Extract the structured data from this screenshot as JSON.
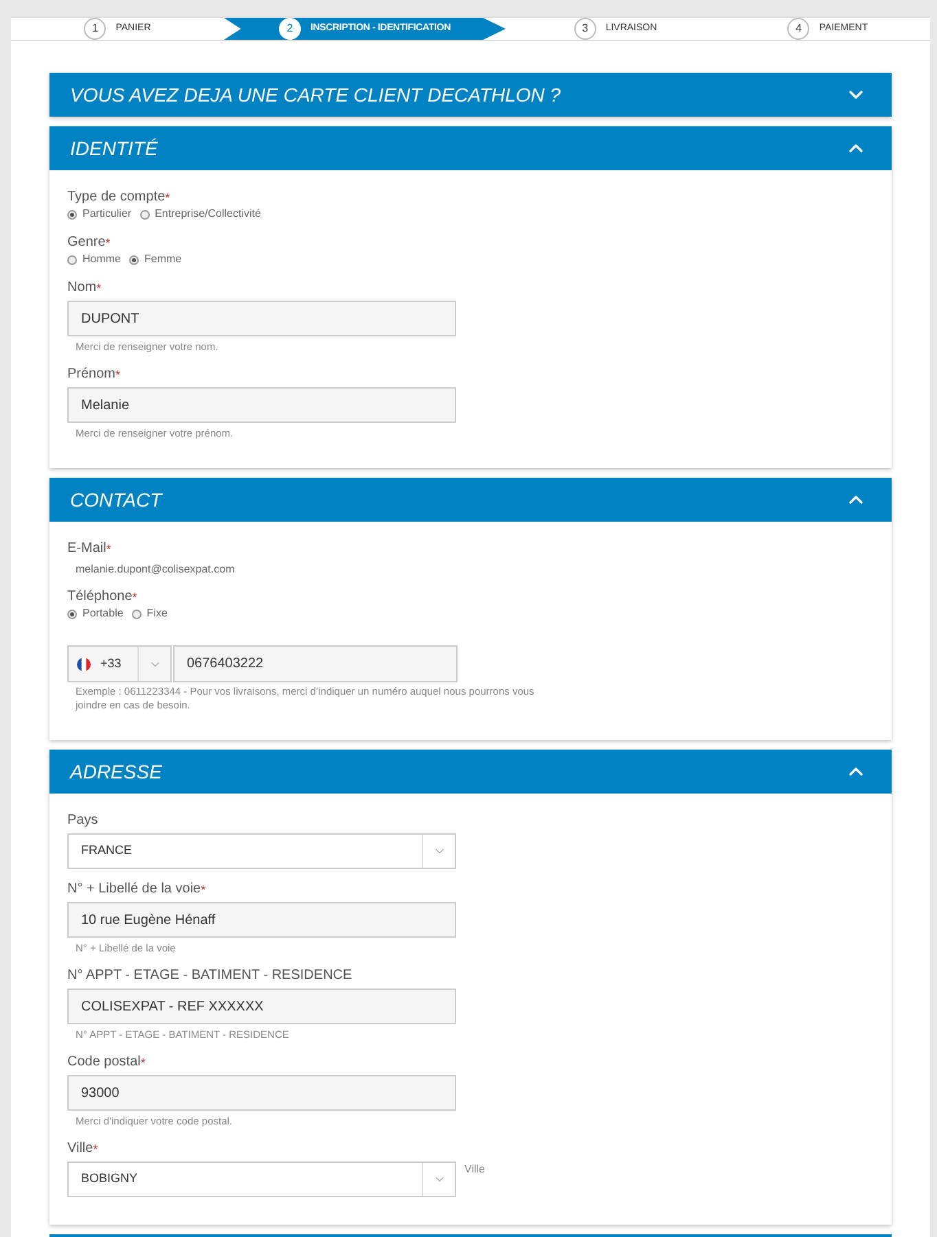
{
  "steps": [
    {
      "number": "1",
      "label": "PANIER",
      "selected": false
    },
    {
      "number": "2",
      "label": "INSCRIPTION - IDENTIFICATION",
      "selected": true
    },
    {
      "number": "3",
      "label": "LIVRAISON",
      "selected": false
    },
    {
      "number": "4",
      "label": "PAIEMENT",
      "selected": false
    }
  ],
  "sections": [
    {
      "title": "VOUS AVEZ DEJA UNE CARTE CLIENT DECATHLON ?",
      "expanded": false
    },
    {
      "title": "IDENTITÉ",
      "expanded": true,
      "fields": [
        {
          "kind": "radio",
          "label": "Type de compte",
          "required_mark": "*",
          "options": [
            {
              "label": "Particulier",
              "selected": true
            },
            {
              "label": "Entreprise/Collectivité",
              "selected": false
            }
          ]
        },
        {
          "kind": "radio",
          "label": "Genre",
          "required_mark": "*",
          "options": [
            {
              "label": "Homme",
              "selected": false
            },
            {
              "label": "Femme",
              "selected": true
            }
          ]
        },
        {
          "kind": "input",
          "label": "Nom",
          "required_mark": "*",
          "value": "DUPONT",
          "help": "Merci de renseigner votre nom."
        },
        {
          "kind": "input",
          "label": "Prénom",
          "required_mark": "*",
          "value": "Melanie",
          "help": "Merci de renseigner votre prénom."
        }
      ]
    },
    {
      "title": "CONTACT",
      "expanded": true,
      "fields": [
        {
          "kind": "text",
          "label": "E-Mail",
          "required_mark": "*",
          "value": "melanie.dupont@colisexpat.com"
        },
        {
          "kind": "radio",
          "label": "Téléphone",
          "required_mark": "*",
          "options": [
            {
              "label": "Portable",
              "selected": true
            },
            {
              "label": "Fixe",
              "selected": false
            }
          ]
        },
        {
          "kind": "phone",
          "code": "+33",
          "value": "0676403222",
          "help": "Exemple : 0611223344 - Pour vos livraisons, merci d’indiquer un numéro auquel nous pourrons vous joindre en cas de besoin."
        }
      ]
    },
    {
      "title": "ADRESSE",
      "expanded": true,
      "fields": [
        {
          "kind": "select",
          "label": "Pays",
          "value": "FRANCE"
        },
        {
          "kind": "input",
          "label": "N° + Libellé de la voie",
          "required_mark": "*",
          "value": "10 rue Eugène Hénaff",
          "help": "N° + Libellé de la voie"
        },
        {
          "kind": "input",
          "label": "N° APPT - ETAGE - BATIMENT - RESIDENCE",
          "value": "COLISEXPAT - REF XXXXXX",
          "help": "N° APPT - ETAGE - BATIMENT - RESIDENCE"
        },
        {
          "kind": "input",
          "label": "Code postal",
          "required_mark": "*",
          "value": "93000",
          "help": "Merci d'indiquer votre code postal."
        },
        {
          "kind": "select",
          "label": "Ville",
          "required_mark": "*",
          "value": "BOBIGNY",
          "side_label": "Ville"
        }
      ]
    }
  ]
}
